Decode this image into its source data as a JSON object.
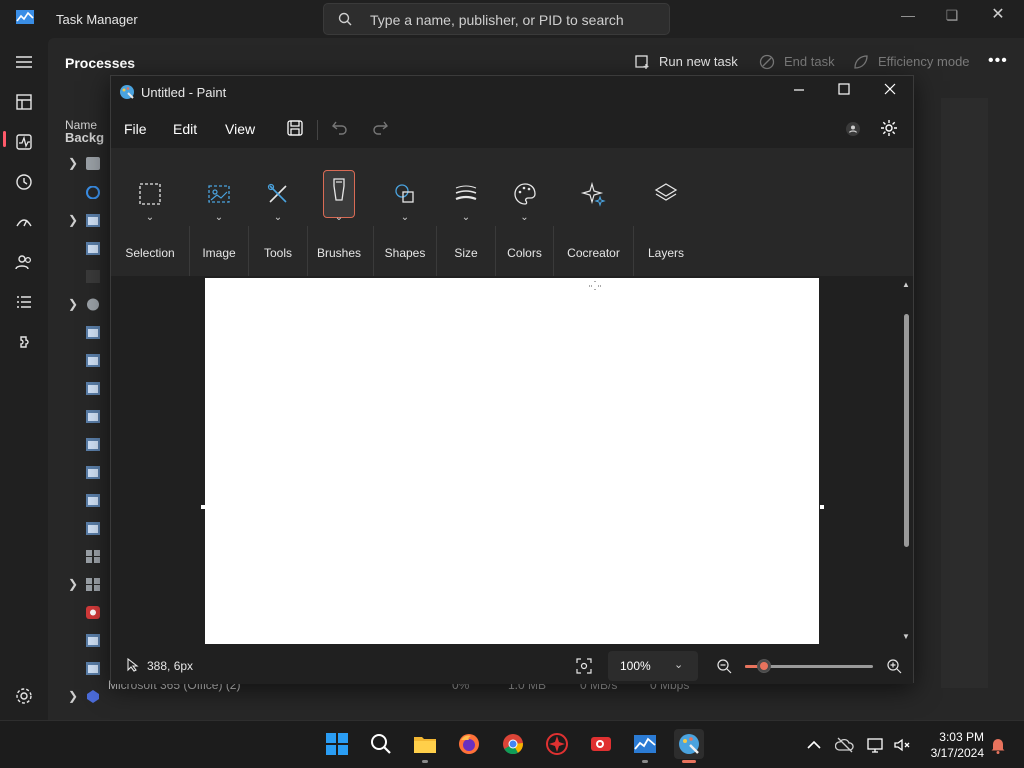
{
  "task_manager": {
    "title": "Task Manager",
    "search_placeholder": "Type a name, publisher, or PID to search",
    "page_title": "Processes",
    "commands": {
      "run_new_task": "Run new task",
      "end_task": "End task",
      "efficiency_mode": "Efficiency mode"
    },
    "column_name": "Name",
    "group_label_partial": "Backg",
    "last_row": {
      "name": "Microsoft 365 (Office) (2)",
      "cpu": "0%",
      "memory": "1.0 MB",
      "disk": "0 MB/s",
      "network": "0 Mbps"
    }
  },
  "paint": {
    "title": "Untitled - Paint",
    "menu": [
      "File",
      "Edit",
      "View"
    ],
    "ribbon": [
      "Selection",
      "Image",
      "Tools",
      "Brushes",
      "Shapes",
      "Size",
      "Colors",
      "Cocreator",
      "Layers"
    ],
    "selected_tool": "Brushes",
    "status": {
      "coordinates": "388, 6px",
      "zoom": "100%",
      "zoom_level": 0.15
    }
  },
  "taskbar": {
    "time": "3:03 PM",
    "date": "3/17/2024",
    "apps": [
      "start-icon",
      "search-icon",
      "file-explorer-icon",
      "firefox-icon",
      "chrome-icon",
      "screen-recorder-icon",
      "video-recorder-icon",
      "task-manager-icon",
      "paint-icon"
    ]
  },
  "colors": {
    "accent": "#e8735d",
    "nav_selected": "#ff5a6a",
    "windows_blue": "#0a84ff"
  }
}
